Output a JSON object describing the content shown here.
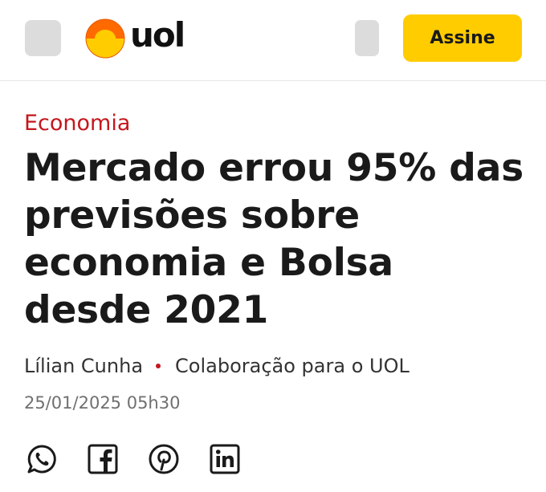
{
  "header": {
    "brand": "uol",
    "subscribe_label": "Assine"
  },
  "article": {
    "category": "Economia",
    "headline": "Mercado errou 95% das previsões sobre economia e Bolsa desde 2021",
    "author": "Lílian Cunha",
    "source": "Colaboração para o UOL",
    "datetime": "25/01/2025 05h30"
  },
  "share": {
    "icons": [
      "whatsapp-icon",
      "facebook-icon",
      "pinterest-icon",
      "linkedin-icon"
    ]
  },
  "colors": {
    "accent_red": "#c4171d",
    "subscribe_yellow": "#ffcc00",
    "logo_orange": "#ff6a00",
    "logo_yellow": "#ffcc00"
  }
}
